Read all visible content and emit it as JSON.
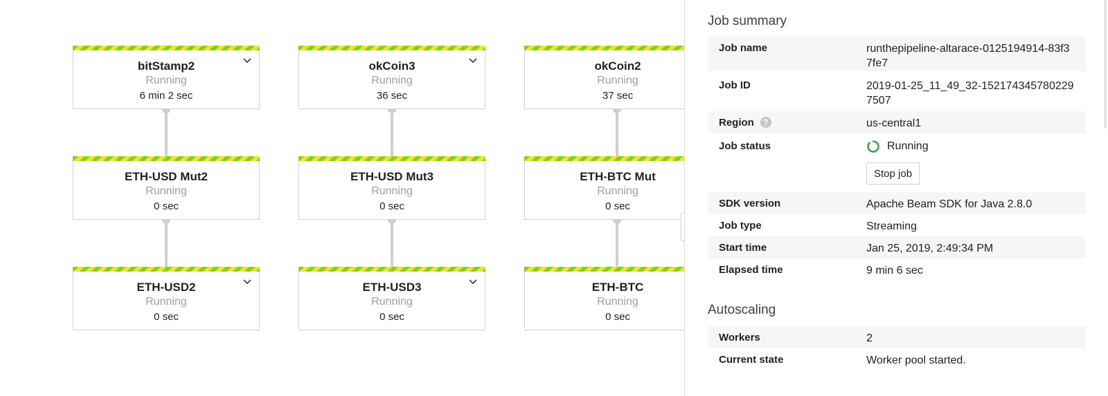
{
  "graph": {
    "nodes": [
      {
        "title": "bitStamp2",
        "status": "Running",
        "time": "6 min 2 sec",
        "expand": true
      },
      {
        "title": "okCoin3",
        "status": "Running",
        "time": "36 sec",
        "expand": true
      },
      {
        "title": "okCoin2",
        "status": "Running",
        "time": "37 sec",
        "expand": false
      },
      {
        "title": "ETH-USD Mut2",
        "status": "Running",
        "time": "0 sec",
        "expand": false
      },
      {
        "title": "ETH-USD Mut3",
        "status": "Running",
        "time": "0 sec",
        "expand": false
      },
      {
        "title": "ETH-BTC Mut",
        "status": "Running",
        "time": "0 sec",
        "expand": false
      },
      {
        "title": "ETH-USD2",
        "status": "Running",
        "time": "0 sec",
        "expand": true
      },
      {
        "title": "ETH-USD3",
        "status": "Running",
        "time": "0 sec",
        "expand": true
      },
      {
        "title": "ETH-BTC",
        "status": "Running",
        "time": "0 sec",
        "expand": false
      }
    ],
    "stripe_colors": [
      "#7ed321",
      "#f5e02c"
    ]
  },
  "summary": {
    "title": "Job summary",
    "job_name_label": "Job name",
    "job_name": "runthepipeline-altarace-0125194914-83f37fe7",
    "job_id_label": "Job ID",
    "job_id": "2019-01-25_11_49_32-1521743457802297507",
    "region_label": "Region",
    "region_help_icon": "help-icon",
    "region": "us-central1",
    "status_label": "Job status",
    "status": "Running",
    "status_color": "#34a853",
    "stop_label": "Stop job",
    "sdk_label": "SDK version",
    "sdk": "Apache Beam SDK for Java 2.8.0",
    "type_label": "Job type",
    "type": "Streaming",
    "start_label": "Start time",
    "start": "Jan 25, 2019, 2:49:34 PM",
    "elapsed_label": "Elapsed time",
    "elapsed": "9 min 6 sec"
  },
  "autoscaling": {
    "title": "Autoscaling",
    "workers_label": "Workers",
    "workers": "2",
    "state_label": "Current state",
    "state": "Worker pool started."
  }
}
